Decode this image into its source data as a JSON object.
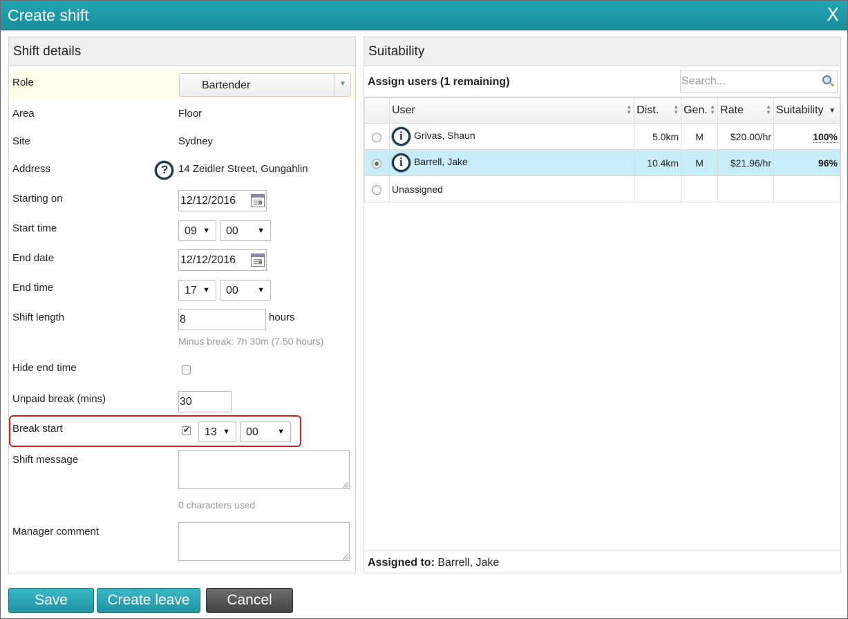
{
  "window": {
    "title": "Create shift",
    "close_glyph": "X"
  },
  "shift_details": {
    "heading": "Shift details",
    "role": {
      "label": "Role",
      "value": "Bartender"
    },
    "area": {
      "label": "Area",
      "value": "Floor"
    },
    "site": {
      "label": "Site",
      "value": "Sydney"
    },
    "address": {
      "label": "Address",
      "value": "14 Zeidler Street, Gungahlin",
      "icon": "help-icon"
    },
    "starting_on": {
      "label": "Starting on",
      "value": "12/12/2016"
    },
    "start_time": {
      "label": "Start time",
      "hour": "09",
      "minute": "00"
    },
    "end_date": {
      "label": "End date",
      "value": "12/12/2016"
    },
    "end_time": {
      "label": "End time",
      "hour": "17",
      "minute": "00"
    },
    "shift_length": {
      "label": "Shift length",
      "value": "8",
      "unit": "hours",
      "hint": "Minus break: 7h 30m (7.50 hours)"
    },
    "hide_end_time": {
      "label": "Hide end time",
      "checked": false
    },
    "unpaid_break": {
      "label": "Unpaid break (mins)",
      "value": "30"
    },
    "break_start": {
      "label": "Break start",
      "checked": true,
      "hour": "13",
      "minute": "00"
    },
    "shift_message": {
      "label": "Shift message",
      "value": "",
      "hint": "0 characters used"
    },
    "manager_comment": {
      "label": "Manager comment",
      "value": ""
    }
  },
  "suitability": {
    "heading": "Suitability",
    "assign_label": "Assign users (1 remaining)",
    "search_placeholder": "Search...",
    "columns": {
      "user": "User",
      "dist": "Dist.",
      "gen": "Gen.",
      "rate": "Rate",
      "suitability": "Suitability"
    },
    "rows": [
      {
        "name": "Grivas, Shaun",
        "dist": "5.0km",
        "gen": "M",
        "rate": "$20.00/hr",
        "suitability": "100%",
        "selected": false
      },
      {
        "name": "Barrell, Jake",
        "dist": "10.4km",
        "gen": "M",
        "rate": "$21.96/hr",
        "suitability": "96%",
        "selected": true
      },
      {
        "name": "Unassigned",
        "dist": "",
        "gen": "",
        "rate": "",
        "suitability": "",
        "selected": false
      }
    ],
    "assigned_label": "Assigned to:",
    "assigned_value": "Barrell, Jake"
  },
  "buttons": {
    "save": "Save",
    "create_leave": "Create leave",
    "cancel": "Cancel"
  },
  "colors": {
    "titlebar": "#1b8e9c",
    "primary_button": "#1f93a2",
    "cancel_button": "#444444",
    "highlight": "#d9221f",
    "selected_row": "#c8edf9",
    "suitability_good": "#3cbf3c"
  }
}
